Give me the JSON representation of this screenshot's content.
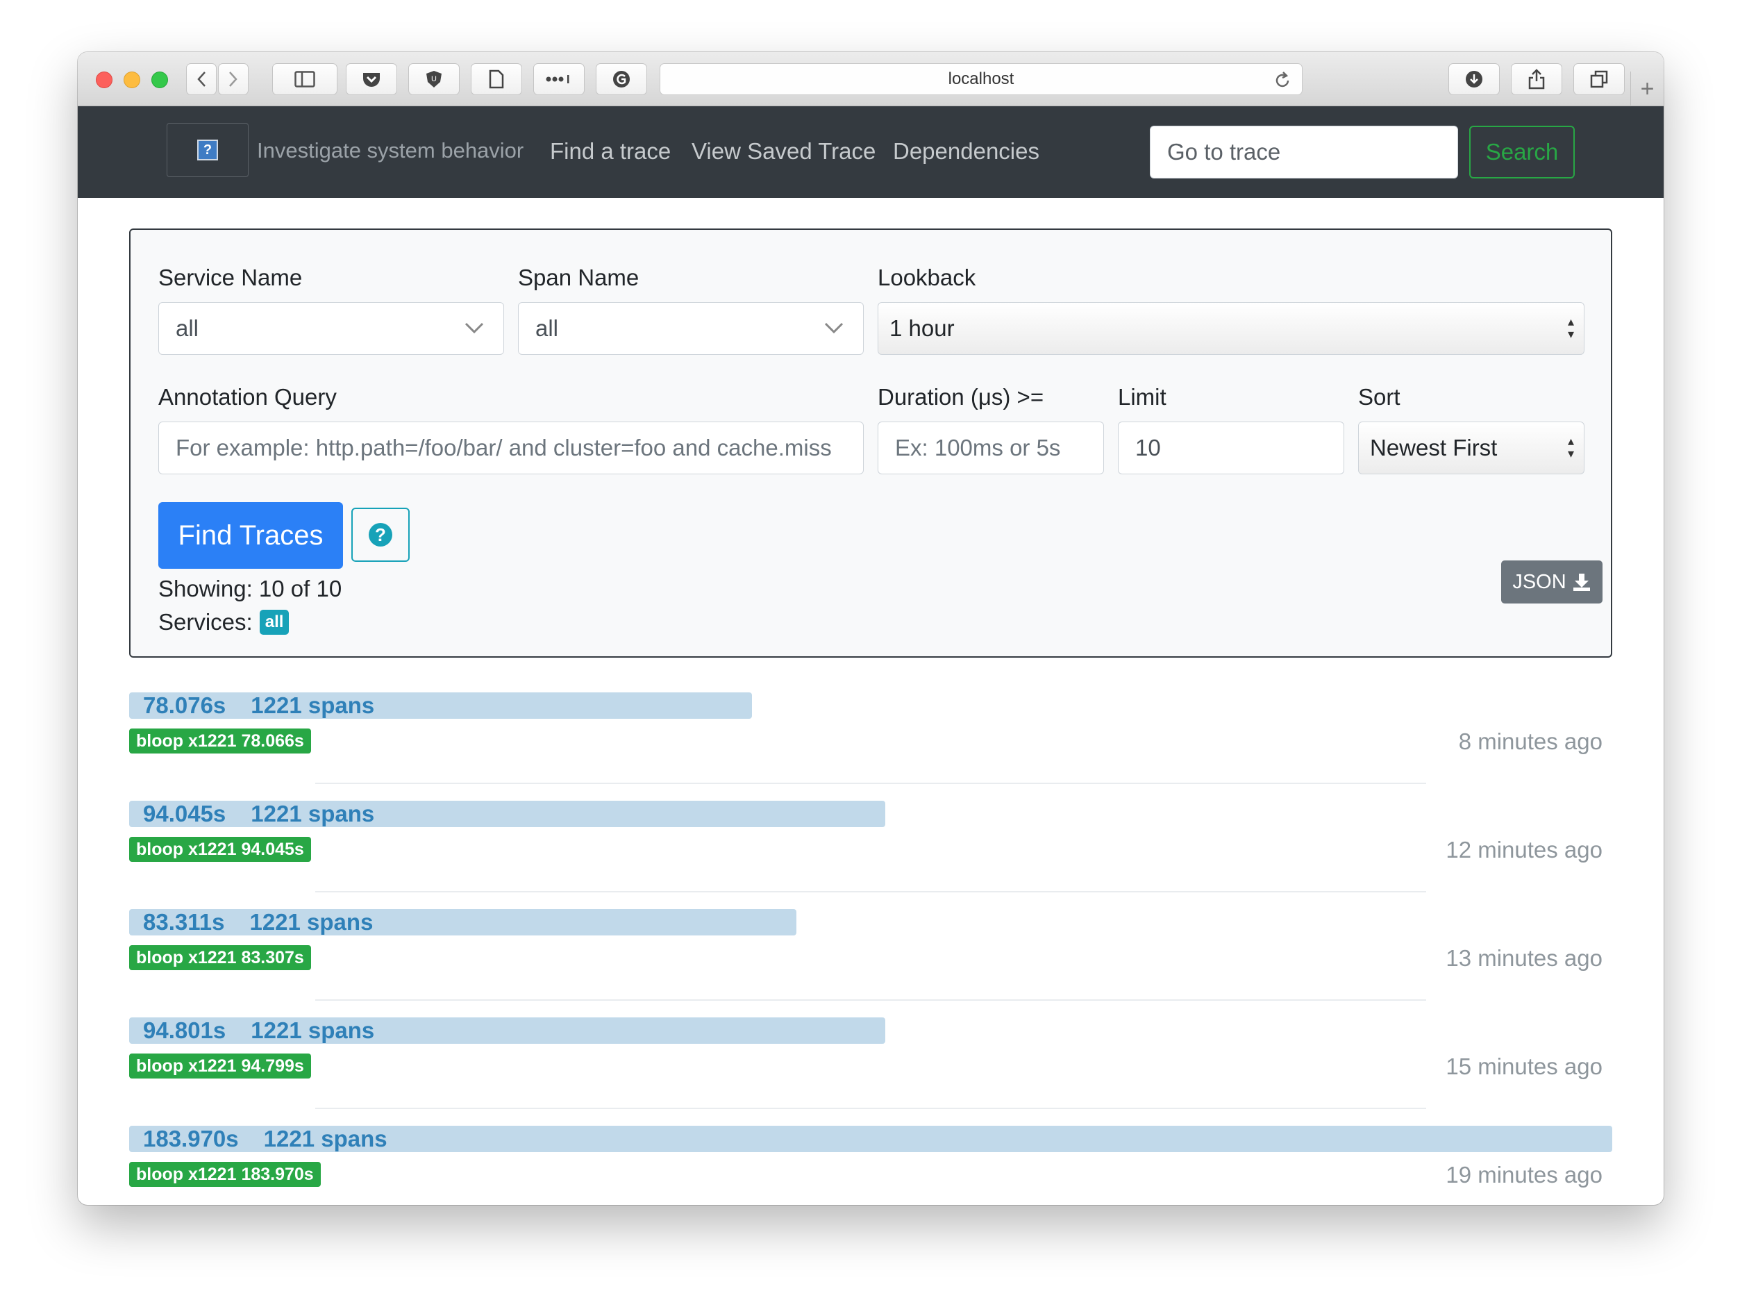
{
  "browser": {
    "url": "localhost"
  },
  "navbar": {
    "tagline": "Investigate system behavior",
    "links": [
      "Find a trace",
      "View Saved Trace",
      "Dependencies"
    ],
    "goto_placeholder": "Go to trace",
    "search_label": "Search"
  },
  "form": {
    "service_label": "Service Name",
    "service_value": "all",
    "span_label": "Span Name",
    "span_value": "all",
    "lookback_label": "Lookback",
    "lookback_value": "1 hour",
    "annotation_label": "Annotation Query",
    "annotation_placeholder": "For example: http.path=/foo/bar/ and cluster=foo and cache.miss",
    "duration_label": "Duration (μs) >=",
    "duration_placeholder": "Ex: 100ms or 5s",
    "limit_label": "Limit",
    "limit_value": "10",
    "sort_label": "Sort",
    "sort_value": "Newest First",
    "find_label": "Find Traces",
    "showing": "Showing: 10 of 10",
    "services_label": "Services:",
    "services_badge": "all",
    "json_label": "JSON"
  },
  "traces": [
    {
      "duration": "78.076s",
      "spans": "1221 spans",
      "service": "bloop x1221 78.066s",
      "ago": "8 minutes ago",
      "fraction": 0.42
    },
    {
      "duration": "94.045s",
      "spans": "1221 spans",
      "service": "bloop x1221 94.045s",
      "ago": "12 minutes ago",
      "fraction": 0.51
    },
    {
      "duration": "83.311s",
      "spans": "1221 spans",
      "service": "bloop x1221 83.307s",
      "ago": "13 minutes ago",
      "fraction": 0.45
    },
    {
      "duration": "94.801s",
      "spans": "1221 spans",
      "service": "bloop x1221 94.799s",
      "ago": "15 minutes ago",
      "fraction": 0.51
    },
    {
      "duration": "183.970s",
      "spans": "1221 spans",
      "service": "bloop x1221 183.970s",
      "ago": "19 minutes ago",
      "fraction": 1.0
    }
  ]
}
